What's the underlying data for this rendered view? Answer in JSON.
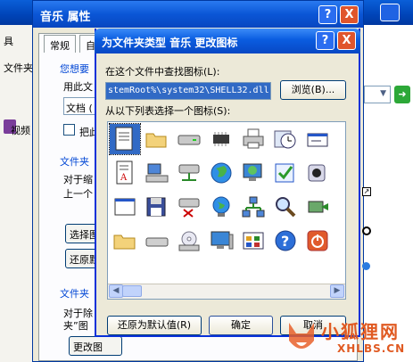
{
  "background": {
    "menu_items": [
      "具",
      "文件夹"
    ],
    "video_label": "视频"
  },
  "props_dialog": {
    "title": "音乐 属性",
    "help_glyph": "?",
    "close_glyph": "X",
    "tabs": [
      "常规",
      "自"
    ],
    "group1_label": "您想要",
    "line1": "用此文",
    "dropdown": "文档 (",
    "checkbox_label": "把此",
    "group2_label": "文件夹",
    "desc2a": "对于缩",
    "desc2b": "上一个",
    "choose_btn": "选择图",
    "restore_btn": "还原默",
    "group3_label": "文件夹",
    "desc3a": "对于除",
    "desc3b": "夹”图",
    "change_btn": "更改图"
  },
  "change_icon_dialog": {
    "title": "为文件夹类型 音乐 更改图标",
    "search_label": "在这个文件中查找图标(L):",
    "path_value": "stemRoot%\\system32\\SHELL32.dll",
    "browse_button": "浏览(B)...",
    "select_label": "从以下列表选择一个图标(S):",
    "restore_default_button": "还原为默认值(R)",
    "ok_button": "确定",
    "cancel_button": "取消"
  },
  "watermark": {
    "name": "小狐狸网",
    "url": "XHLBS.CN"
  }
}
